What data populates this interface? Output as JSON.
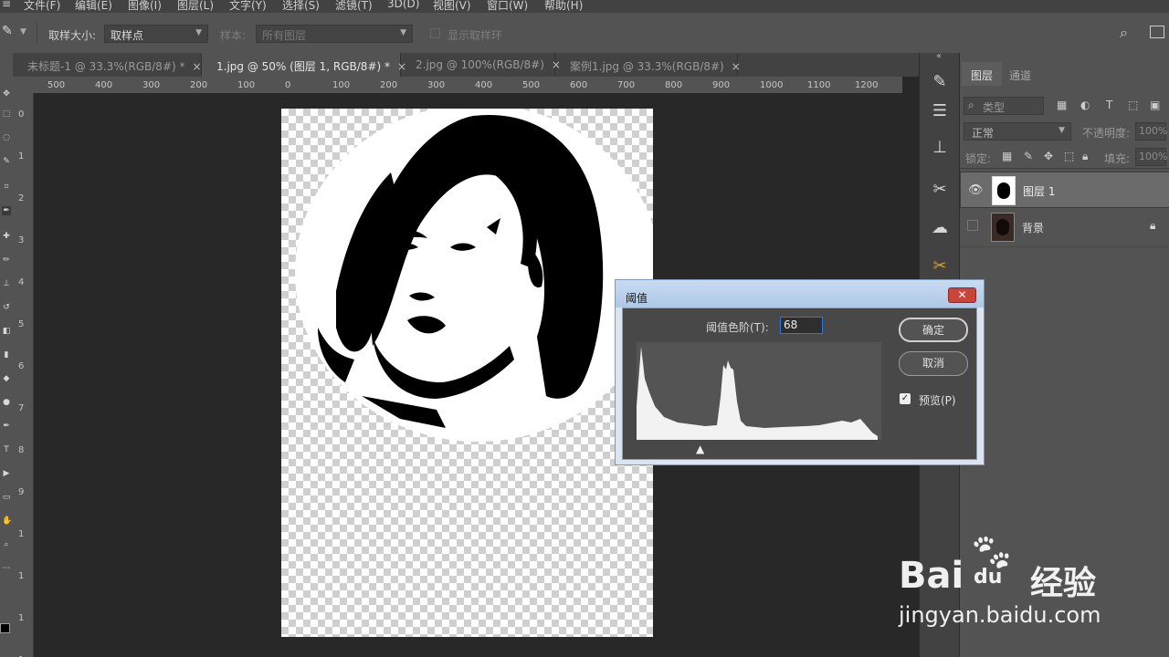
{
  "menu": [
    "文件(F)",
    "编辑(E)",
    "图像(I)",
    "图层(L)",
    "文字(Y)",
    "选择(S)",
    "滤镜(T)",
    "3D(D)",
    "视图(V)",
    "窗口(W)",
    "帮助(H)"
  ],
  "options": {
    "size_label": "取样大小:",
    "size_value": "取样点",
    "sample_label": "样本:",
    "sample_value": "所有图层",
    "ring_label": "显示取样环"
  },
  "tabs": [
    {
      "label": "未标题-1 @ 33.3%(RGB/8#) *",
      "active": false
    },
    {
      "label": "1.jpg @ 50% (图层 1, RGB/8#) *",
      "active": true
    },
    {
      "label": "2.jpg @ 100%(RGB/8#)",
      "active": false
    },
    {
      "label": "案例1.jpg @ 33.3%(RGB/8#)",
      "active": false
    }
  ],
  "ruler_h": [
    "500",
    "400",
    "300",
    "200",
    "100",
    "0",
    "100",
    "200",
    "300",
    "400",
    "500",
    "600",
    "700",
    "800",
    "900",
    "1000",
    "1100",
    "1200"
  ],
  "ruler_v": [
    "0",
    "1",
    "2",
    "3",
    "4",
    "5",
    "6",
    "7",
    "8",
    "9",
    "1",
    "1",
    "1",
    "1"
  ],
  "panel": {
    "tabs": [
      "图层",
      "通道"
    ],
    "kind_label": "类型",
    "blend_mode": "正常",
    "opacity_label": "不透明度:",
    "opacity_value": "100%",
    "lock_label": "锁定:",
    "fill_label": "填充:",
    "fill_value": "100%",
    "layers": [
      {
        "name": "图层 1",
        "visible": true,
        "selected": true
      },
      {
        "name": "背景",
        "visible": false,
        "selected": false,
        "locked": true
      }
    ]
  },
  "dialog": {
    "title": "阈值",
    "level_label": "阈值色阶(T):",
    "level_value": "68",
    "ok": "确定",
    "cancel": "取消",
    "preview_label": "预览(P)",
    "preview_checked": true
  },
  "watermark": {
    "brand": "Bai",
    "brand2": "du",
    "suffix": "经验",
    "url": "jingyan.baidu.com"
  },
  "colors": {
    "accent": "#2a7ad7",
    "dialog_bg": "#dbe5f1",
    "close": "#c9443a"
  }
}
